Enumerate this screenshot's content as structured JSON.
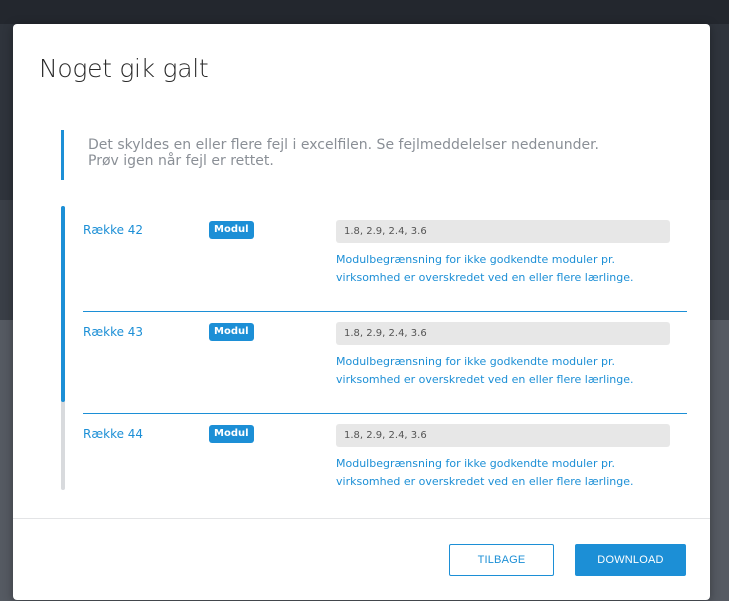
{
  "dialog": {
    "title": "Noget gik galt",
    "info_line_1": "Det skyldes en eller flere fejl i excelfilen. Se fejlmeddelelser nedenunder.",
    "info_line_2": "Prøv igen når fejl er rettet."
  },
  "errors": [
    {
      "row_label": "Række 42",
      "badge": "Modul",
      "value": "1.8, 2.9, 2.4, 3.6",
      "message": "Modulbegrænsning for ikke godkendte moduler pr. virksomhed er overskredet ved en eller flere lærlinge."
    },
    {
      "row_label": "Række 43",
      "badge": "Modul",
      "value": "1.8, 2.9, 2.4, 3.6",
      "message": "Modulbegrænsning for ikke godkendte moduler pr. virksomhed er overskredet ved en eller flere lærlinge."
    },
    {
      "row_label": "Række 44",
      "badge": "Modul",
      "value": "1.8, 2.9, 2.4, 3.6",
      "message": "Modulbegrænsning for ikke godkendte moduler pr. virksomhed er overskredet ved en eller flere lærlinge."
    }
  ],
  "footer": {
    "back_label": "TILBAGE",
    "download_label": "DOWNLOAD"
  },
  "colors": {
    "accent": "#1c8fd6",
    "title_text": "#2a2a2a",
    "info_text": "#8a8f96",
    "field_bg": "#e7e7e7",
    "scroll_track": "#d8dadd",
    "overlay": "#2f343c"
  }
}
